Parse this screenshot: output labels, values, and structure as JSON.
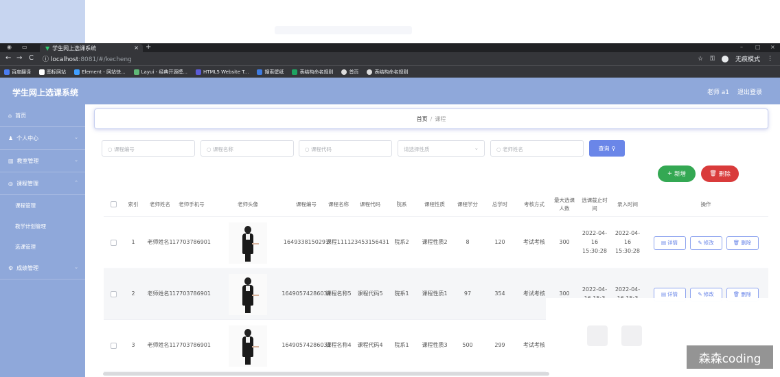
{
  "browser": {
    "tab_title": "学生网上选课系统",
    "url_host": "localhost",
    "url_rest": ":8081/#/kecheng",
    "profile_label": "无痕模式",
    "bookmarks": [
      "百度翻译",
      "图标网站",
      "Element - 网站快...",
      "Layui - 经典开源模...",
      "HTML5 Website T...",
      "搜索壁纸",
      "表结构命名规则",
      "首页",
      "表结构命名规则"
    ]
  },
  "app": {
    "title": "学生网上选课系统",
    "user_label": "老师 a1",
    "logout_label": "退出登录"
  },
  "sidebar": {
    "items": [
      {
        "label": "首页"
      },
      {
        "label": "个人中心"
      },
      {
        "label": "教室管理"
      },
      {
        "label": "课程管理"
      },
      {
        "label": "成绩管理"
      }
    ],
    "subitems": [
      "课程管理",
      "教学计划管理",
      "选课管理"
    ]
  },
  "breadcrumb": {
    "home": "首页",
    "separator": "/",
    "current": "课程"
  },
  "filters": {
    "course_no": "课程编号",
    "course_name": "课程名称",
    "course_code": "课程代码",
    "course_type": "请选择性质",
    "teacher_name": "老师姓名",
    "search_label": "查询"
  },
  "actions": {
    "add_label": "新增",
    "delete_label": "删除"
  },
  "table": {
    "headers": [
      "索引",
      "老师姓名",
      "老师手机号",
      "老师头像",
      "课程编号",
      "课程名称",
      "课程代码",
      "院系",
      "课程性质",
      "课程学分",
      "总学时",
      "考核方式",
      "最大选课人数",
      "选课截止时间",
      "录入时间",
      "操作"
    ],
    "op_labels": {
      "detail": "详情",
      "edit": "修改",
      "delete": "删除"
    },
    "rows": [
      {
        "index": "1",
        "teacher": "老师姓名1",
        "phone": "17703786901",
        "course_no": "1649338150291",
        "course_name": "课程1111",
        "course_code": "23453156431",
        "dept": "院系2",
        "nature": "课程性质2",
        "credit": "8",
        "hours": "120",
        "exam": "考试考核",
        "max": "300",
        "deadline": "2022-04-16 15:30:28",
        "created": "2022-04-16 15:30:28"
      },
      {
        "index": "2",
        "teacher": "老师姓名1",
        "phone": "17703786901",
        "course_no": "16490574286038",
        "course_name": "课程名称5",
        "course_code": "课程代码5",
        "dept": "院系1",
        "nature": "课程性质1",
        "credit": "97",
        "hours": "354",
        "exam": "考试考核",
        "max": "300",
        "deadline": "2022-04-16 15:3",
        "created": "2022-04-16 15:3"
      },
      {
        "index": "3",
        "teacher": "老师姓名1",
        "phone": "17703786901",
        "course_no": "16490574286031",
        "course_name": "课程名称4",
        "course_code": "课程代码4",
        "dept": "院系1",
        "nature": "课程性质3",
        "credit": "500",
        "hours": "299",
        "exam": "考试考核",
        "max": "",
        "deadline": "",
        "created": ""
      }
    ]
  },
  "watermark": "森森coding"
}
